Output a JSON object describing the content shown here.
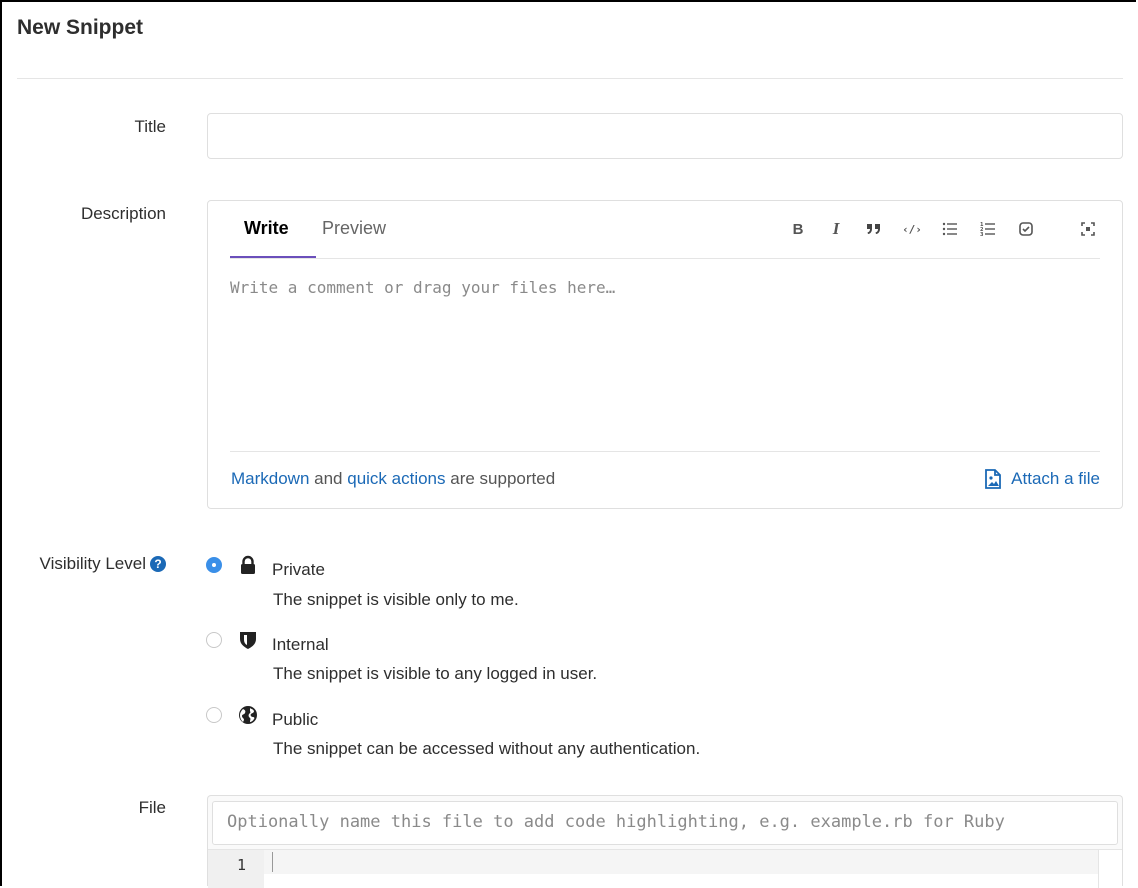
{
  "page": {
    "title": "New Snippet"
  },
  "form": {
    "title_label": "Title",
    "description_label": "Description",
    "visibility_label": "Visibility Level",
    "file_label": "File"
  },
  "editor": {
    "tabs": [
      {
        "label": "Write",
        "active": true
      },
      {
        "label": "Preview",
        "active": false
      }
    ],
    "toolbar": [
      {
        "name": "bold",
        "glyph": "B"
      },
      {
        "name": "italic",
        "glyph": "I"
      },
      {
        "name": "quote",
        "glyph": "❞"
      },
      {
        "name": "code",
        "glyph": "‹/›"
      },
      {
        "name": "bullet-list",
        "glyph": "☰"
      },
      {
        "name": "numbered-list",
        "glyph": "☷"
      },
      {
        "name": "task-list",
        "glyph": "☑"
      },
      {
        "name": "fullscreen",
        "glyph": "⛶"
      }
    ],
    "placeholder": "Write a comment or drag your files here…",
    "footer": {
      "markdown_link": "Markdown",
      "and_text": " and ",
      "quick_actions_link": "quick actions",
      "supported_text": " are supported",
      "attach_label": "Attach a file"
    }
  },
  "visibility": {
    "options": [
      {
        "name": "Private",
        "description": "The snippet is visible only to me.",
        "icon": "lock-icon",
        "checked": true
      },
      {
        "name": "Internal",
        "description": "The snippet is visible to any logged in user.",
        "icon": "shield-icon",
        "checked": false
      },
      {
        "name": "Public",
        "description": "The snippet can be accessed without any authentication.",
        "icon": "globe-icon",
        "checked": false
      }
    ]
  },
  "file": {
    "placeholder": "Optionally name this file to add code highlighting, e.g. example.rb for Ruby",
    "line_number": "1"
  },
  "colors": {
    "link": "#1b69b6",
    "radio_checked": "#3a8fe8",
    "active_tab": "#6b4fbb"
  }
}
